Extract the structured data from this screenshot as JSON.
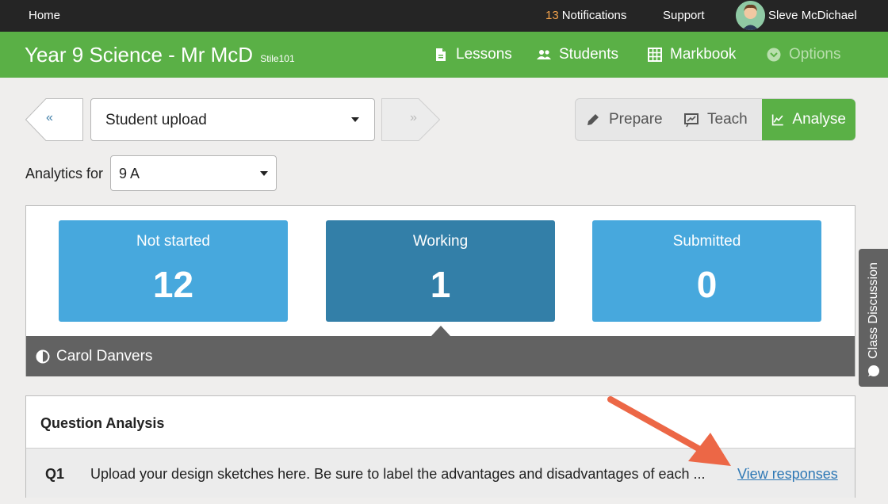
{
  "topbar": {
    "home": "Home",
    "notifications_count": "13",
    "notifications_label": "Notifications",
    "support": "Support",
    "user_name": "Sleve McDichael"
  },
  "header": {
    "title": "Year 9 Science - Mr McD",
    "subtitle": "Stile101",
    "nav": {
      "lessons": "Lessons",
      "students": "Students",
      "markbook": "Markbook",
      "options": "Options"
    }
  },
  "toolbar": {
    "prev": "«",
    "next": "»",
    "lesson_selected": "Student upload",
    "modes": {
      "prepare": "Prepare",
      "teach": "Teach",
      "analyse": "Analyse"
    },
    "active_mode": "Analyse"
  },
  "analytics": {
    "label": "Analytics for",
    "class_selected": "9 A"
  },
  "stats": [
    {
      "label": "Not started",
      "value": "12"
    },
    {
      "label": "Working",
      "value": "1"
    },
    {
      "label": "Submitted",
      "value": "0"
    }
  ],
  "student_bar": {
    "name": "Carol Danvers"
  },
  "side_tab": {
    "label": "Class Discussion"
  },
  "question_analysis": {
    "title": "Question Analysis",
    "rows": [
      {
        "number": "Q1",
        "text": "Upload your design sketches here. Be sure to label the advantages and disadvantages of each ...",
        "action": "View responses"
      }
    ]
  },
  "colors": {
    "brand_green": "#5ab046",
    "stat_blue": "#47a8dd",
    "stat_selected": "#337fa8",
    "notification_count": "#f0a04b",
    "annotation_arrow": "#ec6746"
  }
}
